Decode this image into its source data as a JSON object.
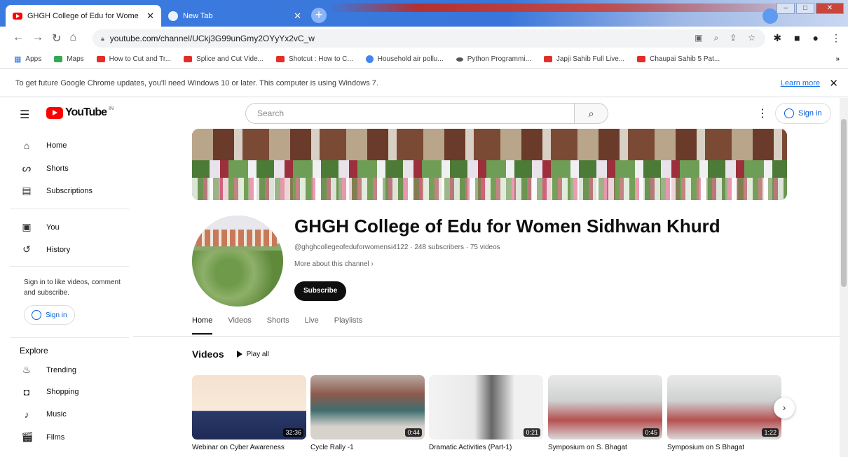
{
  "browser": {
    "tabs": [
      {
        "title": "GHGH College of Edu for Wome"
      },
      {
        "title": "New Tab"
      }
    ],
    "url": "youtube.com/channel/UCkj3G99unGmy2OYyYx2vC_w",
    "bookmarks": [
      {
        "label": "Apps"
      },
      {
        "label": "Maps"
      },
      {
        "label": "How to Cut and Tr..."
      },
      {
        "label": "Splice and Cut Vide..."
      },
      {
        "label": "Shotcut : How to C..."
      },
      {
        "label": "Household air pollu..."
      },
      {
        "label": "Python Programmi..."
      },
      {
        "label": "Japji Sahib Full Live..."
      },
      {
        "label": "Chaupai Sahib 5 Pat..."
      }
    ],
    "infobar": {
      "message": "To get future Google Chrome updates, you'll need Windows 10 or later. This computer is using Windows 7.",
      "learn_more": "Learn more"
    }
  },
  "youtube": {
    "logo_text": "YouTube",
    "logo_badge": "IN",
    "search_placeholder": "Search",
    "signin_label": "Sign in",
    "sidebar": {
      "items": [
        {
          "label": "Home"
        },
        {
          "label": "Shorts"
        },
        {
          "label": "Subscriptions"
        },
        {
          "label": "You"
        },
        {
          "label": "History"
        }
      ],
      "signin_note": "Sign in to like videos, comment and subscribe.",
      "signin_label": "Sign in",
      "explore_heading": "Explore",
      "explore_items": [
        {
          "label": "Trending"
        },
        {
          "label": "Shopping"
        },
        {
          "label": "Music"
        },
        {
          "label": "Films"
        }
      ]
    },
    "channel": {
      "name": "GHGH College of Edu for Women Sidhwan Khurd",
      "meta": "@ghghcollegeofeduforwomensi4122 · 248 subscribers · 75 videos",
      "more_about": "More about this channel",
      "subscribe_label": "Subscribe"
    },
    "tabs": [
      {
        "label": "Home"
      },
      {
        "label": "Videos"
      },
      {
        "label": "Shorts"
      },
      {
        "label": "Live"
      },
      {
        "label": "Playlists"
      }
    ],
    "videos_section": {
      "heading": "Videos",
      "play_all": "Play all",
      "items": [
        {
          "title": "Webinar on Cyber Awareness",
          "duration": "32:36"
        },
        {
          "title": "Cycle Rally -1",
          "duration": "0:44"
        },
        {
          "title": "Dramatic Activities (Part-1)",
          "duration": "0:21"
        },
        {
          "title": "Symposium on S. Bhagat",
          "duration": "0:45"
        },
        {
          "title": "Symposium on S Bhagat",
          "duration": "1:22"
        }
      ]
    }
  }
}
